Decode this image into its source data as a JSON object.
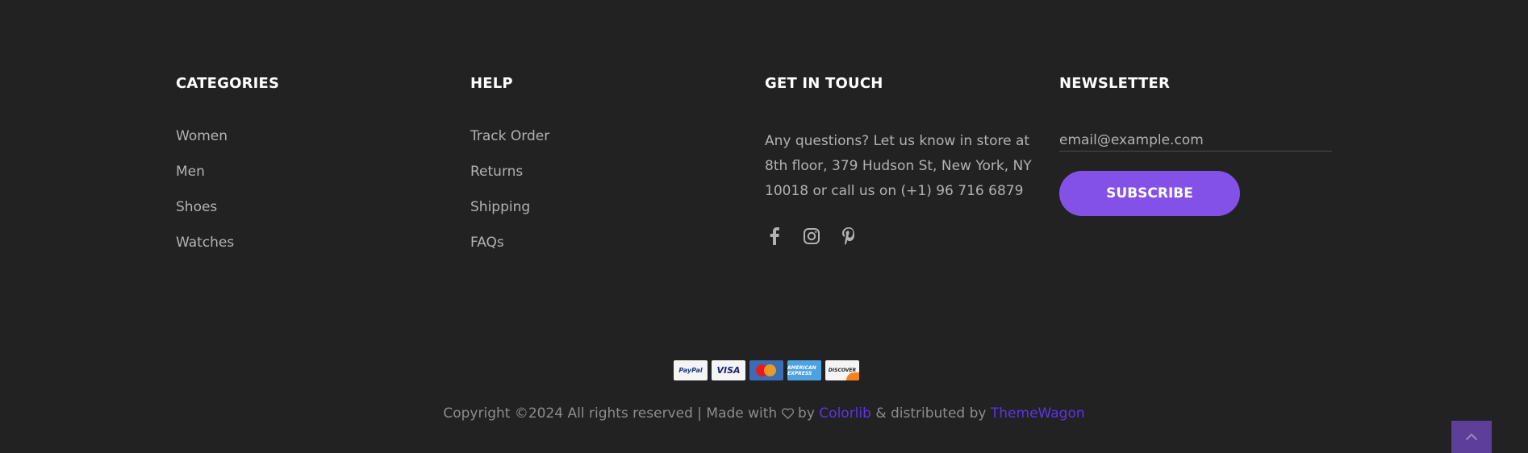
{
  "categories": {
    "title": "CATEGORIES",
    "items": [
      "Women",
      "Men",
      "Shoes",
      "Watches"
    ]
  },
  "help": {
    "title": "HELP",
    "items": [
      "Track Order",
      "Returns",
      "Shipping",
      "FAQs"
    ]
  },
  "get_in_touch": {
    "title": "GET IN TOUCH",
    "text": "Any questions? Let us know in store at 8th floor, 379 Hudson St, New York, NY 10018 or call us on (+1) 96 716 6879",
    "socials": [
      "facebook-icon",
      "instagram-icon",
      "pinterest-icon"
    ]
  },
  "newsletter": {
    "title": "NEWSLETTER",
    "placeholder": "email@example.com",
    "button": "SUBSCRIBE"
  },
  "payments": {
    "paypal": "PayPal",
    "visa": "VISA",
    "amex": "AMERICAN EXPRESS",
    "discover": "DISCOVER"
  },
  "copyright": {
    "prefix": "Copyright ©2024 All rights reserved | Made with",
    "by": "by",
    "colorlib": "Colorlib",
    "distributed": "& distributed by",
    "themewagon": "ThemeWagon"
  },
  "colors": {
    "background": "#222222",
    "accent": "#8451e8",
    "link_accent": "#5b34e8",
    "back_to_top": "#5d3e99"
  }
}
